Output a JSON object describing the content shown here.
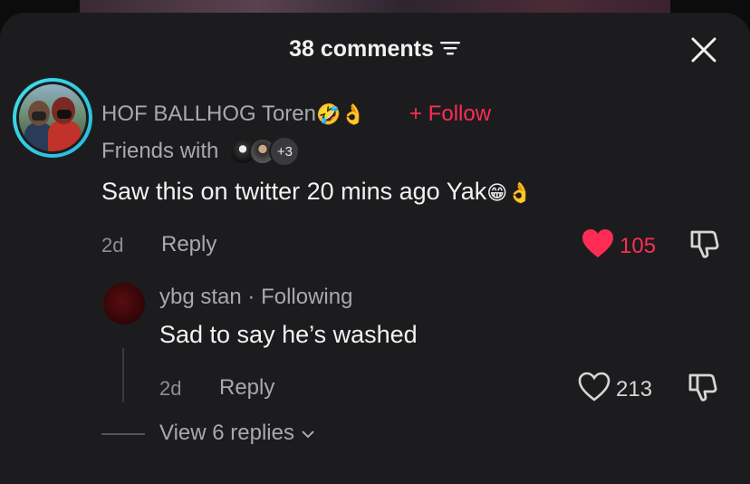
{
  "header": {
    "comments_count_label": "38 comments",
    "filter_icon": "filter-icon",
    "close_icon": "close-icon"
  },
  "comment": {
    "username": "HOF BALLHOG Toren",
    "username_emojis": "🤣👌",
    "follow_label": "+ Follow",
    "friends_label": "Friends with",
    "friends_extra_count": "+3",
    "text": "Saw this on twitter 20 mins ago Yak",
    "text_emojis": "😁👌",
    "time": "2d",
    "reply_label": "Reply",
    "likes": "105",
    "liked": true
  },
  "reply": {
    "username": "ybg stan",
    "separator": "·",
    "relation": "Following",
    "text": "Sad to say he’s washed",
    "time": "2d",
    "reply_label": "Reply",
    "likes": "213",
    "liked": false
  },
  "view_replies_label": "View 6 replies",
  "colors": {
    "accent": "#fe2c55",
    "sheet_bg": "#1c1c1e",
    "ring": "#3fe0e8"
  }
}
